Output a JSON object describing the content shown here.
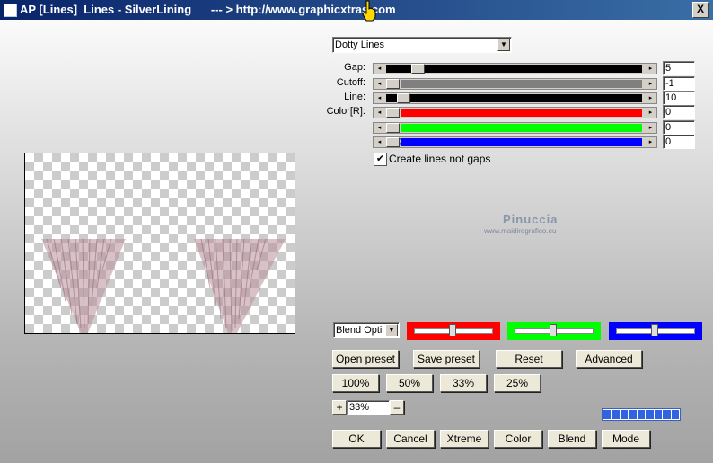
{
  "window": {
    "title": "AP [Lines]  Lines - SilverLining      --- > http://www.graphicxtras.com",
    "close_label": "X"
  },
  "preset_dropdown": {
    "value": "Dotty Lines"
  },
  "sliders": [
    {
      "label": "Gap:",
      "value": "5",
      "color": "#000000"
    },
    {
      "label": "Cutoff:",
      "value": "-1",
      "color": "#808080"
    },
    {
      "label": "Line:",
      "value": "10",
      "color": "#000000"
    },
    {
      "label": "Color[R]:",
      "value": "0",
      "color": "#ff0000"
    },
    {
      "label": "",
      "value": "0",
      "color": "#00ff00"
    },
    {
      "label": "",
      "value": "0",
      "color": "#0000ff"
    }
  ],
  "checkbox": {
    "label": "Create lines not gaps",
    "checked": true
  },
  "watermark": {
    "name": "Pinuccia",
    "site": "www.maidiregrafico.eu"
  },
  "blend": {
    "value": "Blend Opti"
  },
  "color_swatches": [
    "#ff0000",
    "#00ff00",
    "#0000ff"
  ],
  "buttons": {
    "open_preset": "Open preset",
    "save_preset": "Save preset",
    "reset": "Reset",
    "advanced": "Advanced",
    "z100": "100%",
    "z50": "50%",
    "z33": "33%",
    "z25": "25%",
    "plus": "+",
    "minus": "–",
    "ok": "OK",
    "cancel": "Cancel",
    "xtreme": "Xtreme",
    "color": "Color",
    "blend": "Blend",
    "mode": "Mode"
  },
  "zoom": {
    "value": "33%"
  },
  "progress": {
    "filled_segments": 9,
    "total_segments": 9
  }
}
